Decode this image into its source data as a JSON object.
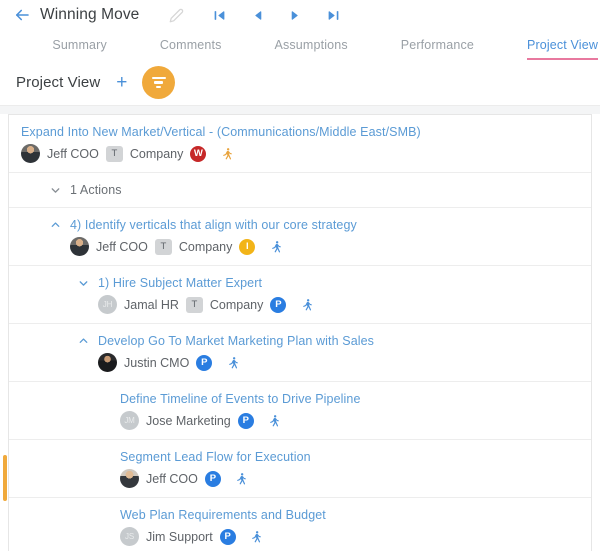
{
  "header": {
    "title": "Winning Move",
    "back_icon": "back-arrow-icon",
    "edit_icon": "pencil-icon",
    "nav": [
      {
        "name": "skip-first",
        "icon": "skip-to-first-icon"
      },
      {
        "name": "previous",
        "icon": "previous-icon"
      },
      {
        "name": "next",
        "icon": "next-icon"
      },
      {
        "name": "skip-last",
        "icon": "skip-to-last-icon"
      }
    ]
  },
  "tabs": [
    {
      "label": "Summary",
      "active": false
    },
    {
      "label": "Comments",
      "active": false
    },
    {
      "label": "Assumptions",
      "active": false
    },
    {
      "label": "Performance",
      "active": false
    },
    {
      "label": "Project View",
      "active": true
    }
  ],
  "toolbar": {
    "title": "Project View",
    "add_label": "+",
    "filter_icon": "filter-funnel-icon"
  },
  "colors": {
    "accent_blue": "#5b9bd5",
    "link_blue": "#4a90d9",
    "orange": "#f0a93b",
    "tab_underline": "#e8799f",
    "badge_red": "#c62828",
    "badge_yellow": "#f2b418",
    "badge_blue": "#2a7de1"
  },
  "rows": [
    {
      "id": "root",
      "title": "Expand Into New Market/Vertical - (Communications/Middle East/SMB)",
      "indent": 0,
      "chevron": "none",
      "title_color": "blue",
      "avatar": "photo-a",
      "avatar_initials": "",
      "name": "Jeff COO",
      "type_badge": "T",
      "company": "Company",
      "status_badge": "W",
      "status_color": "#c62828",
      "person_icon_color": "#e8a33d"
    },
    {
      "id": "actions",
      "title": "1 Actions",
      "indent": 1,
      "chevron": "down",
      "title_color": "gray",
      "avatar": null
    },
    {
      "id": "action-4",
      "title": "4) Identify verticals that align with our core strategy",
      "indent": 2,
      "chevron": "up",
      "title_color": "blue",
      "avatar": "photo-a",
      "avatar_initials": "",
      "name": "Jeff COO",
      "type_badge": "T",
      "company": "Company",
      "status_badge": "I",
      "status_color": "#f2b418",
      "person_icon_color": "#4a90d9"
    },
    {
      "id": "task-1",
      "title": "1) Hire Subject Matter Expert",
      "indent": 3,
      "chevron": "down",
      "title_color": "blue",
      "avatar": "initials",
      "avatar_initials": "JH",
      "name": "Jamal HR",
      "type_badge": "T",
      "company": "Company",
      "status_badge": "P",
      "status_color": "#2a7de1",
      "person_icon_color": "#4a90d9"
    },
    {
      "id": "task-develop",
      "title": "Develop Go To Market Marketing Plan with Sales",
      "indent": 3,
      "chevron": "up",
      "title_color": "blue",
      "avatar": "photo-b",
      "avatar_initials": "",
      "name": "Justin CMO",
      "type_badge": null,
      "company": null,
      "status_badge": "P",
      "status_color": "#2a7de1",
      "person_icon_color": "#4a90d9"
    },
    {
      "id": "sub-timeline",
      "title": "Define Timeline of Events to Drive Pipeline",
      "indent": 4,
      "chevron": "none",
      "title_color": "blue",
      "avatar": "initials",
      "avatar_initials": "JM",
      "name": "Jose Marketing",
      "type_badge": null,
      "company": null,
      "status_badge": "P",
      "status_color": "#2a7de1",
      "person_icon_color": "#4a90d9"
    },
    {
      "id": "sub-segment",
      "title": "Segment Lead Flow for Execution",
      "indent": 4,
      "chevron": "none",
      "title_color": "blue",
      "avatar": "photo-c",
      "avatar_initials": "",
      "name": "Jeff COO",
      "type_badge": null,
      "company": null,
      "status_badge": "P",
      "status_color": "#2a7de1",
      "person_icon_color": "#4a90d9"
    },
    {
      "id": "sub-webplan",
      "title": "Web Plan Requirements and Budget",
      "indent": 4,
      "chevron": "none",
      "title_color": "blue",
      "avatar": "initials",
      "avatar_initials": "JS",
      "name": "Jim Support",
      "type_badge": null,
      "company": null,
      "status_badge": "P",
      "status_color": "#2a7de1",
      "person_icon_color": "#4a90d9"
    }
  ]
}
